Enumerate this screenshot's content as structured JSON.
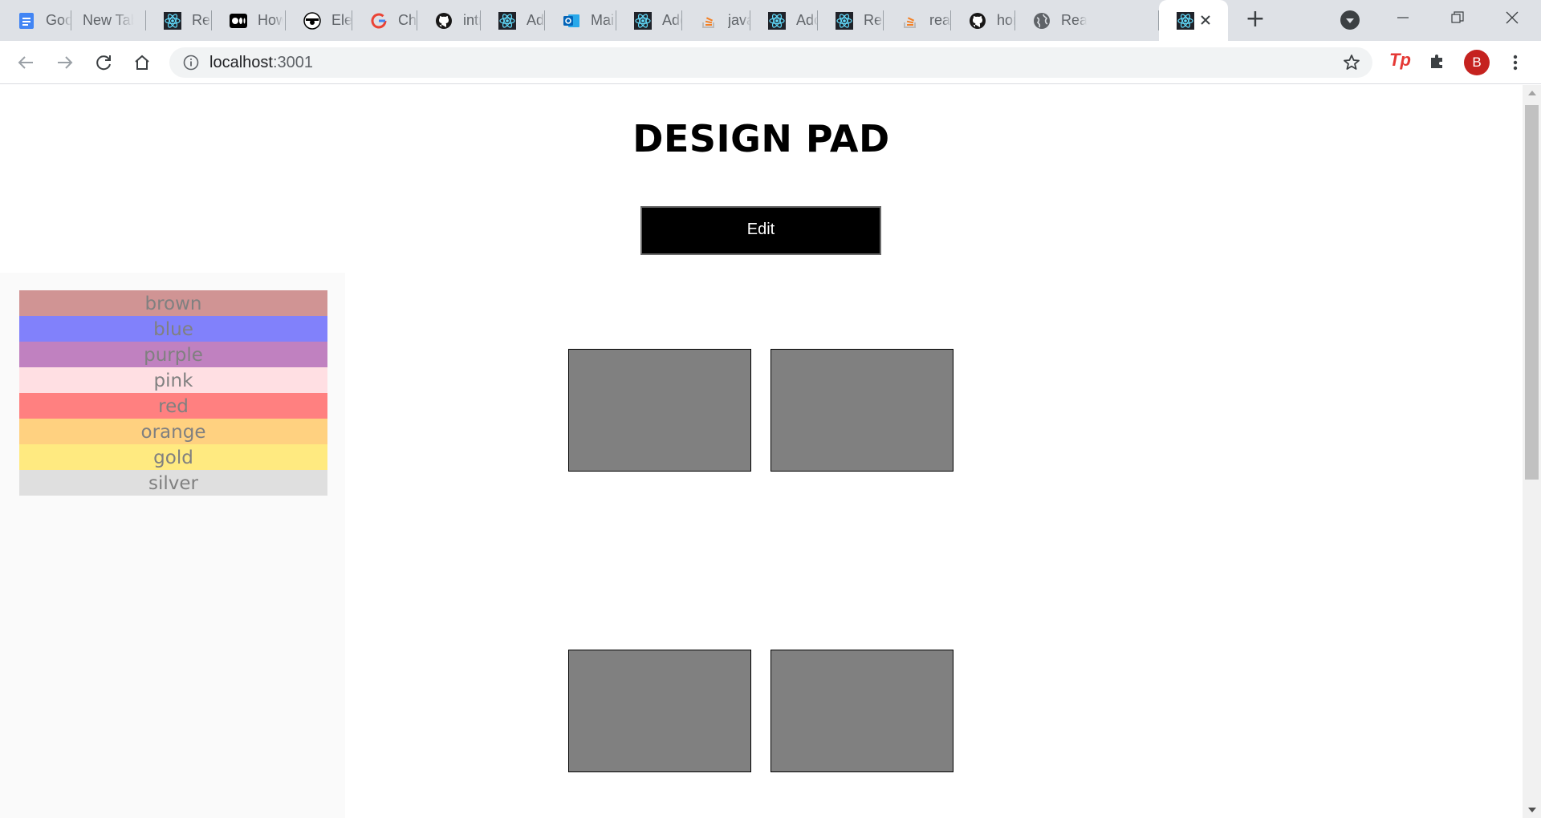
{
  "browser": {
    "tabs": [
      {
        "title": "Goo",
        "icon": "google-docs-icon"
      },
      {
        "title": "New Tab",
        "icon": "none"
      },
      {
        "title": "Rea",
        "icon": "react-icon"
      },
      {
        "title": "How",
        "icon": "medium-icon"
      },
      {
        "title": "Elen",
        "icon": "eye-icon"
      },
      {
        "title": "Che",
        "icon": "google-icon"
      },
      {
        "title": "intr",
        "icon": "github-icon"
      },
      {
        "title": "Adc",
        "icon": "react-icon"
      },
      {
        "title": "Mai",
        "icon": "outlook-icon"
      },
      {
        "title": "Adc",
        "icon": "react-icon"
      },
      {
        "title": "java",
        "icon": "stackoverflow-icon"
      },
      {
        "title": "Adc",
        "icon": "react-icon"
      },
      {
        "title": "Rea",
        "icon": "react-icon"
      },
      {
        "title": "reac",
        "icon": "stackoverflow-icon"
      },
      {
        "title": "hon",
        "icon": "github-icon"
      },
      {
        "title": "Rea",
        "icon": "globe-icon"
      },
      {
        "title": "",
        "icon": "react-icon",
        "active": true
      }
    ],
    "url_host": "localhost",
    "url_port": ":3001",
    "avatar_letter": "B",
    "ext_tp": "Tp"
  },
  "page": {
    "title": "DESIGN PAD",
    "edit_label": "Edit"
  },
  "palette": [
    {
      "name": "brown",
      "color": "#d09494"
    },
    {
      "name": "blue",
      "color": "#8181fb"
    },
    {
      "name": "purple",
      "color": "#c081c0"
    },
    {
      "name": "pink",
      "color": "#ffdfe3"
    },
    {
      "name": "red",
      "color": "#ff8080"
    },
    {
      "name": "orange",
      "color": "#ffd180"
    },
    {
      "name": "gold",
      "color": "#ffea80"
    },
    {
      "name": "silver",
      "color": "#dfdfdf"
    }
  ],
  "colors": {
    "box_fill": "#808080",
    "button_bg": "#000000"
  }
}
